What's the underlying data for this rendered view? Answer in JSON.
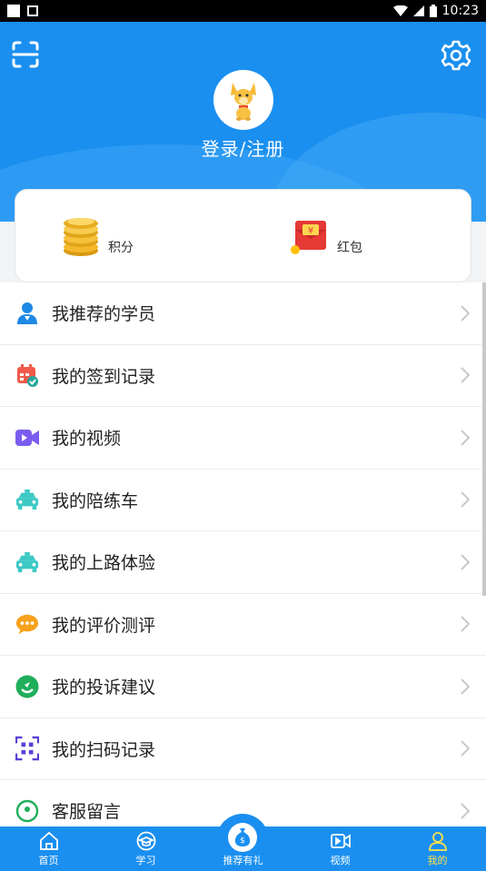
{
  "status_bar": {
    "time": "10:23"
  },
  "header": {
    "login_label": "登录/注册",
    "bg_color": "#1a8ff0"
  },
  "wallet": [
    {
      "label": "积分",
      "icon": "coins-icon"
    },
    {
      "label": "红包",
      "icon": "red-envelope-icon"
    }
  ],
  "menu": [
    {
      "label": "我推荐的学员",
      "icon": "student-icon"
    },
    {
      "label": "我的签到记录",
      "icon": "calendar-check-icon"
    },
    {
      "label": "我的视频",
      "icon": "video-icon"
    },
    {
      "label": "我的陪练车",
      "icon": "car-icon"
    },
    {
      "label": "我的上路体验",
      "icon": "car-icon"
    },
    {
      "label": "我的评价测评",
      "icon": "chat-bubble-icon"
    },
    {
      "label": "我的投诉建议",
      "icon": "feedback-icon"
    },
    {
      "label": "我的扫码记录",
      "icon": "qr-scan-icon"
    },
    {
      "label": "客服留言",
      "icon": "service-icon"
    }
  ],
  "tabs": [
    {
      "label": "首页",
      "icon": "home-icon"
    },
    {
      "label": "学习",
      "icon": "study-icon"
    },
    {
      "label": "推荐有礼",
      "icon": "money-bag-icon"
    },
    {
      "label": "视频",
      "icon": "video-tab-icon"
    },
    {
      "label": "我的",
      "icon": "user-icon",
      "active": true
    }
  ],
  "colors": {
    "primary": "#1a8ff0",
    "active_tab": "#ffe14a"
  }
}
